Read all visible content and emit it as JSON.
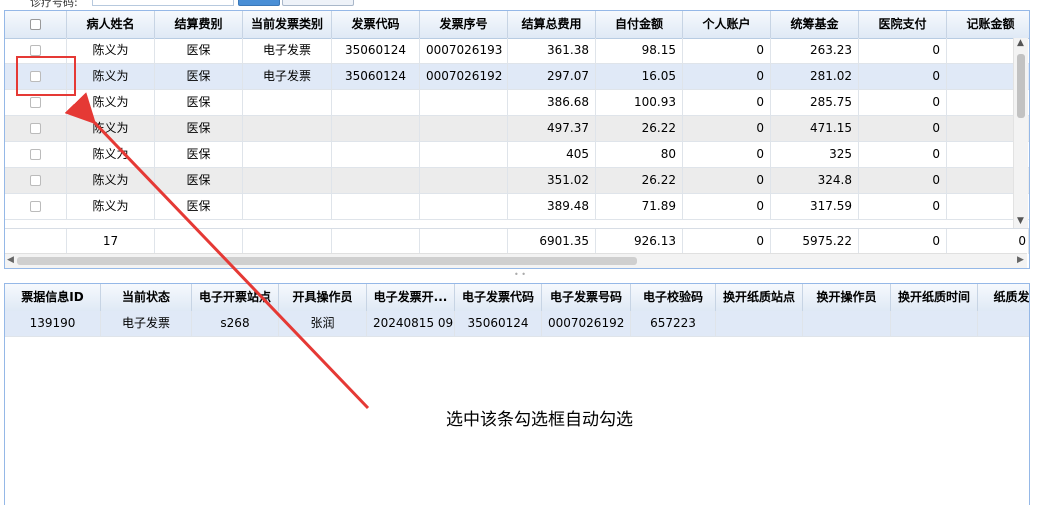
{
  "toolbar": {
    "label": "诊疗号码:"
  },
  "upper_grid": {
    "columns": [
      "病人姓名",
      "结算费别",
      "当前发票类别",
      "发票代码",
      "发票序号",
      "结算总费用",
      "自付金额",
      "个人账户",
      "统筹基金",
      "医院支付",
      "记账金额"
    ],
    "rows": [
      {
        "name": "陈义为",
        "fee_type": "医保",
        "invoice_type": "电子发票",
        "invoice_code": "35060124",
        "invoice_no": "0007026193",
        "total": "361.38",
        "self_pay": "98.15",
        "personal": "0",
        "pool": "263.23",
        "hospital": "0"
      },
      {
        "name": "陈义为",
        "fee_type": "医保",
        "invoice_type": "电子发票",
        "invoice_code": "35060124",
        "invoice_no": "0007026192",
        "total": "297.07",
        "self_pay": "16.05",
        "personal": "0",
        "pool": "281.02",
        "hospital": "0"
      },
      {
        "name": "陈义为",
        "fee_type": "医保",
        "invoice_type": "",
        "invoice_code": "",
        "invoice_no": "",
        "total": "386.68",
        "self_pay": "100.93",
        "personal": "0",
        "pool": "285.75",
        "hospital": "0"
      },
      {
        "name": "陈义为",
        "fee_type": "医保",
        "invoice_type": "",
        "invoice_code": "",
        "invoice_no": "",
        "total": "497.37",
        "self_pay": "26.22",
        "personal": "0",
        "pool": "471.15",
        "hospital": "0"
      },
      {
        "name": "陈义为",
        "fee_type": "医保",
        "invoice_type": "",
        "invoice_code": "",
        "invoice_no": "",
        "total": "405",
        "self_pay": "80",
        "personal": "0",
        "pool": "325",
        "hospital": "0"
      },
      {
        "name": "陈义为",
        "fee_type": "医保",
        "invoice_type": "",
        "invoice_code": "",
        "invoice_no": "",
        "total": "351.02",
        "self_pay": "26.22",
        "personal": "0",
        "pool": "324.8",
        "hospital": "0"
      },
      {
        "name": "陈义为",
        "fee_type": "医保",
        "invoice_type": "",
        "invoice_code": "",
        "invoice_no": "",
        "total": "389.48",
        "self_pay": "71.89",
        "personal": "0",
        "pool": "317.59",
        "hospital": "0"
      }
    ],
    "footer": {
      "name": "17",
      "total": "6901.35",
      "self_pay": "926.13",
      "personal": "0",
      "pool": "5975.22",
      "hospital": "0",
      "accounting": "0"
    }
  },
  "lower_grid": {
    "columns": [
      "票据信息ID",
      "当前状态",
      "电子开票站点",
      "开具操作员",
      "电子发票开...",
      "电子发票代码",
      "电子发票号码",
      "电子校验码",
      "换开纸质站点",
      "换开操作员",
      "换开纸质时间",
      "纸质发票"
    ],
    "rows": [
      {
        "id": "139190",
        "status": "电子发票",
        "site": "s268",
        "operator": "张润",
        "issued": "20240815 09:...",
        "code": "35060124",
        "number": "0007026192",
        "check": "657223",
        "p_site": "",
        "p_operator": "",
        "p_time": "",
        "paper": ""
      }
    ]
  },
  "annotation": {
    "note": "选中该条勾选框自动勾选",
    "color": "#e53935"
  }
}
